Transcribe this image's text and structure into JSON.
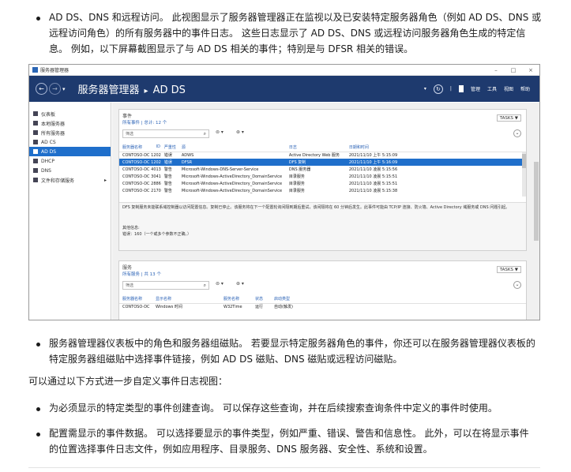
{
  "para1": {
    "lines": [
      "AD DS、DNS 和远程访问。 此视图显示了服务器管理器正在监视以及已安装特定服务器角色（例如 AD DS、DNS 或",
      "远程访问角色）的所有服务器中的事件日志。 这些日志显示了 AD DS、DNS 或远程访问服务器角色生成的特定信",
      "息。 例如，以下屏幕截图显示了与 AD DS 相关的事件；特别是与 DFSR 相关的错误。"
    ]
  },
  "window": {
    "title": "服务器管理器",
    "controls": [
      "–",
      "□",
      "×"
    ],
    "nav": {
      "back": "←",
      "forward": "→",
      "breadcrumb_root": "服务器管理器",
      "breadcrumb_sep": "▸",
      "breadcrumb_current": "AD DS",
      "refresh": "↻",
      "menu": [
        "管理",
        "工具",
        "视图",
        "帮助"
      ]
    },
    "sidebar": [
      {
        "label": "仪表板"
      },
      {
        "label": "本地服务器"
      },
      {
        "label": "所有服务器"
      },
      {
        "label": "AD CS"
      },
      {
        "label": "AD DS"
      },
      {
        "label": "DHCP"
      },
      {
        "label": "DNS"
      },
      {
        "label": "文件和存储服务"
      }
    ],
    "sidebar_arrow": "▸",
    "events": {
      "title": "事件",
      "subtitle": "所有事件 | 总计: 12 个",
      "tasks": "TASKS ▼",
      "filter_placeholder": "筛选",
      "search_glyph": "⌕",
      "filter_btn1": "⊜ ▾",
      "filter_btn2": "⊛ ▾",
      "expand": "⌄",
      "columns": [
        "服务器名称",
        "ID",
        "严重性",
        "源",
        "日志",
        "日期和时间"
      ],
      "rows": [
        [
          "CONTOSO-DC 1202",
          "错误",
          "ADWS",
          "Active Directory Web 服务",
          "2021/11/10 上午 5:15:09"
        ],
        [
          "CONTOSO-DC 1202",
          "错误",
          "DFSR",
          "DFS 复制",
          "2021/11/10 上午 5:16:09"
        ],
        [
          "CONTOSO-DC 4013",
          "警告",
          "Microsoft-Windows-DNS-Server-Service",
          "DNS 服务器",
          "2021/11/10 凌晨 5:15:56"
        ],
        [
          "CONTOSO-DC 3041",
          "警告",
          "Microsoft-Windows-ActiveDirectory_DomainService",
          "目录服务",
          "2021/11/10 凌晨 5:15:51"
        ],
        [
          "CONTOSO-DC 2886",
          "警告",
          "Microsoft-Windows-ActiveDirectory_DomainService",
          "目录服务",
          "2021/11/10 凌晨 5:15:51"
        ],
        [
          "CONTOSO-DC 2170",
          "警告",
          "Microsoft-Windows-ActiveDirectory_DomainService",
          "目录服务",
          "2021/11/10 凌晨 5:15:38"
        ]
      ],
      "detail_text": "DFS 复制服务未能联系域控制器以访问配置信息。复制已停止。该服务将在下一个配置轮询间隔到期后重试，该间隔将在 60 分钟后发生。此事件可能由 TCP/IP 连接、防火墙、Active Directory 域服务或 DNS 问题引起。",
      "extra_label": "其他信息:",
      "extra_value": "错误：160（一个或多个参数不正确。）"
    },
    "services": {
      "title": "服务",
      "subtitle": "所有服务 | 共 13 个",
      "tasks": "TASKS ▼",
      "filter_placeholder": "筛选",
      "search_glyph": "⌕",
      "filter_btn1": "⊜ ▾",
      "filter_btn2": "⊛ ▾",
      "expand": "⌄",
      "columns": [
        "服务器名称",
        "显示名称",
        "服务名称",
        "状态",
        "启动类型"
      ],
      "row": [
        "CONTOSO-DC",
        "Windows 时间",
        "W32Time",
        "运行",
        "自动(触发)"
      ]
    }
  },
  "para2": {
    "lines": [
      "服务器管理器仪表板中的角色和服务器组磁贴。 若要显示特定服务器角色的事件，你还可以在服务器管理器仪表板的",
      "特定服务器组磁贴中选择事件链接，例如 AD DS 磁贴、DNS 磁贴或远程访问磁贴。"
    ]
  },
  "para3": "可以通过以下方式进一步自定义事件日志视图：",
  "para4": "为必须显示的特定类型的事件创建查询。 可以保存这些查询，并在后续搜索查询条件中定义的事件时使用。",
  "para5": {
    "lines": [
      "配置需显示的事件数据。 可以选择要显示的事件类型，例如严重、错误、警告和信息性。 此外，可以在将显示事件",
      "的位置选择事件日志文件，例如应用程序、目录服务、DNS 服务器、安全性、系统和设置。"
    ]
  }
}
